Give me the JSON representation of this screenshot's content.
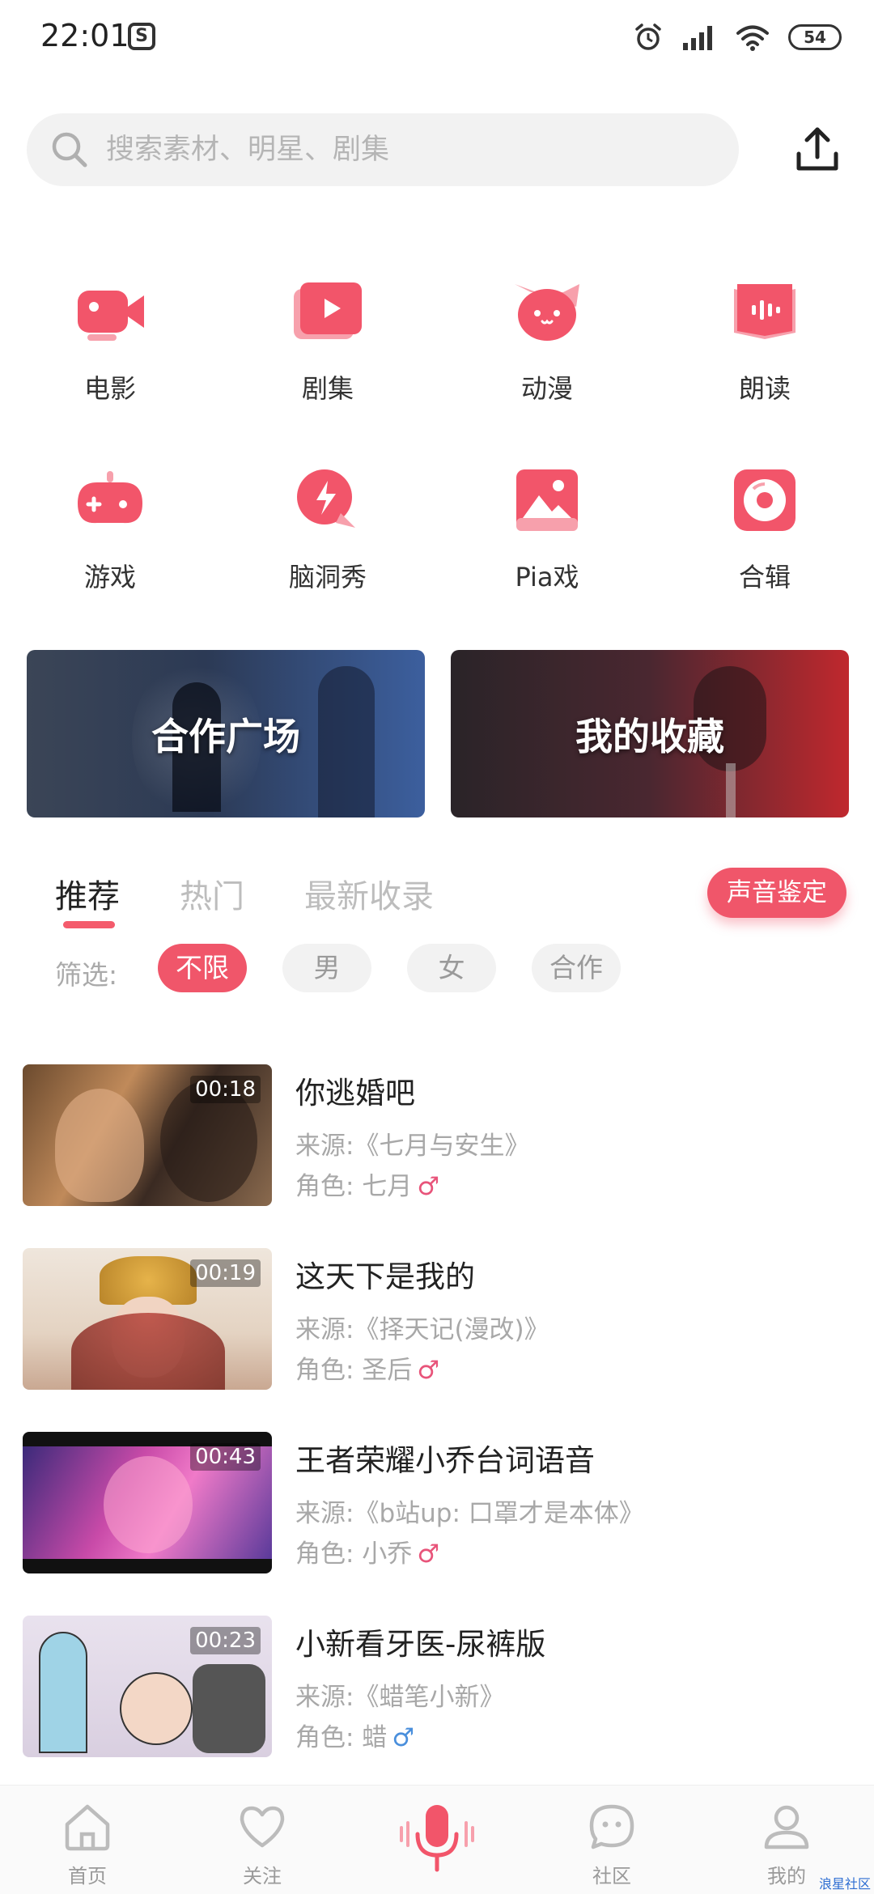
{
  "status_bar": {
    "time": "22:01",
    "battery": "54"
  },
  "search": {
    "placeholder": "搜索素材、明星、剧集"
  },
  "categories": [
    {
      "label": "电影",
      "icon": "movie-camera-icon"
    },
    {
      "label": "剧集",
      "icon": "play-episode-icon"
    },
    {
      "label": "动漫",
      "icon": "cat-face-icon"
    },
    {
      "label": "朗读",
      "icon": "audio-book-icon"
    },
    {
      "label": "游戏",
      "icon": "gamepad-icon"
    },
    {
      "label": "脑洞秀",
      "icon": "lightning-bubble-icon"
    },
    {
      "label": "Pia戏",
      "icon": "picture-icon"
    },
    {
      "label": "合辑",
      "icon": "disc-icon"
    }
  ],
  "banners": {
    "left": "合作广场",
    "right": "我的收藏"
  },
  "tabs": [
    "推荐",
    "热门",
    "最新收录"
  ],
  "voice_button": "声音鉴定",
  "filter": {
    "label": "筛选:",
    "options": [
      "不限",
      "男",
      "女",
      "合作"
    ]
  },
  "items": [
    {
      "duration": "00:18",
      "title": "你逃婚吧",
      "source": "来源:《七月与安生》",
      "role": "角色: 七月",
      "gender": "♂",
      "gender_color": "#e8547a"
    },
    {
      "duration": "00:19",
      "title": "这天下是我的",
      "source": "来源:《择天记(漫改)》",
      "role": "角色: 圣后",
      "gender": "♂",
      "gender_color": "#e8547a"
    },
    {
      "duration": "00:43",
      "title": "王者荣耀小乔台词语音",
      "source": "来源:《b站up: 口罩才是本体》",
      "role": "角色: 小乔",
      "gender": "♂",
      "gender_color": "#e8547a"
    },
    {
      "duration": "00:23",
      "title": "小新看牙医-尿裤版",
      "source": "来源:《蜡笔小新》",
      "role": "角色: 蜡",
      "gender": "♂",
      "gender_color": "#4a8fdc"
    }
  ],
  "bottom_nav": [
    {
      "label": "首页",
      "icon": "home-icon"
    },
    {
      "label": "关注",
      "icon": "heart-icon"
    },
    {
      "label": "",
      "icon": "microphone-icon"
    },
    {
      "label": "社区",
      "icon": "chat-bubble-icon"
    },
    {
      "label": "我的",
      "icon": "profile-icon"
    }
  ],
  "watermark": "浪星社区",
  "colors": {
    "accent": "#f0566a",
    "tab_underline": "#f45b6c"
  }
}
